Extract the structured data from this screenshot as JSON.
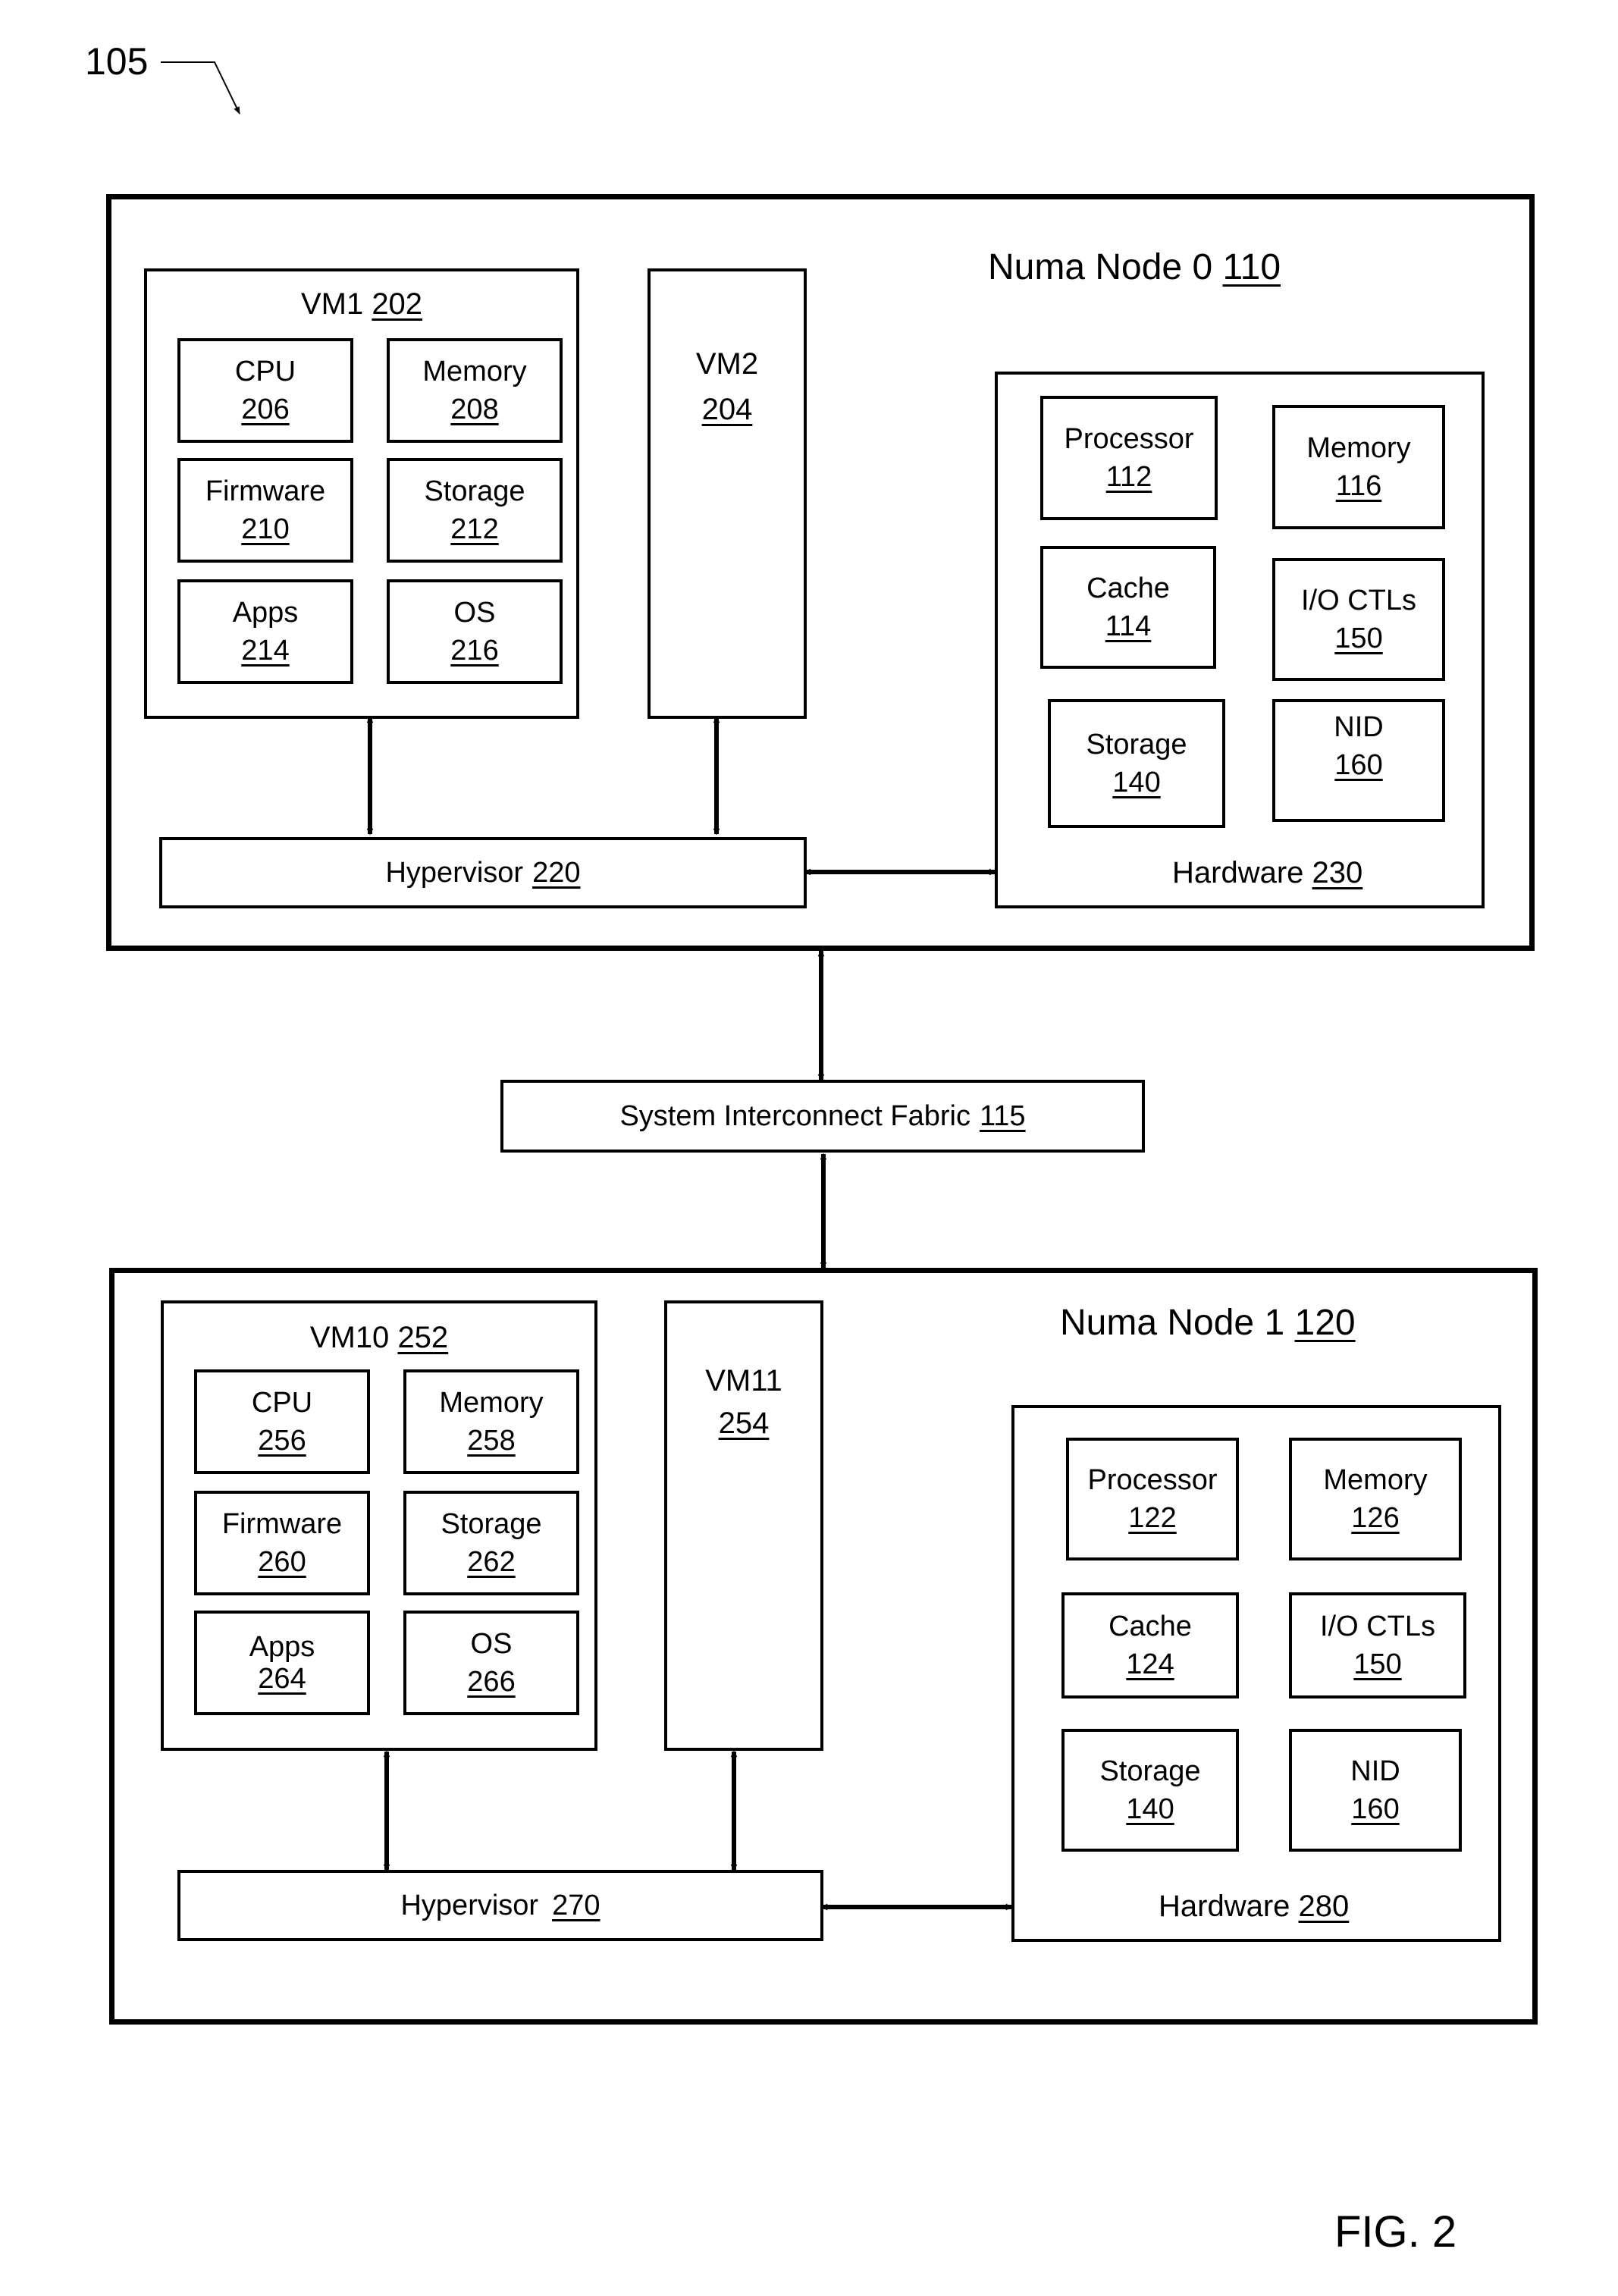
{
  "figure": {
    "reference": "105",
    "caption": "FIG. 2"
  },
  "node0": {
    "name": "Numa Node 0",
    "ref": "110",
    "vm_a": {
      "name": "VM1",
      "ref": "202",
      "components": [
        {
          "name": "CPU",
          "ref": "206"
        },
        {
          "name": "Memory",
          "ref": "208"
        },
        {
          "name": "Firmware",
          "ref": "210"
        },
        {
          "name": "Storage",
          "ref": "212"
        },
        {
          "name": "Apps",
          "ref": "214"
        },
        {
          "name": "OS",
          "ref": "216"
        }
      ]
    },
    "vm_b": {
      "name": "VM2",
      "ref": "204"
    },
    "hypervisor": {
      "name": "Hypervisor",
      "ref": "220"
    },
    "hardware": {
      "name": "Hardware",
      "ref": "230",
      "components": [
        {
          "name": "Processor",
          "ref": "112"
        },
        {
          "name": "Memory",
          "ref": "116"
        },
        {
          "name": "Cache",
          "ref": "114"
        },
        {
          "name": "I/O CTLs",
          "ref": "150"
        },
        {
          "name": "Storage",
          "ref": "140"
        },
        {
          "name": "NID",
          "ref": "160"
        }
      ]
    }
  },
  "fabric": {
    "name": "System Interconnect Fabric",
    "ref": "115"
  },
  "node1": {
    "name": "Numa Node 1",
    "ref": "120",
    "vm_a": {
      "name": "VM10",
      "ref": "252",
      "components": [
        {
          "name": "CPU",
          "ref": "256"
        },
        {
          "name": "Memory",
          "ref": "258"
        },
        {
          "name": "Firmware",
          "ref": "260"
        },
        {
          "name": "Storage",
          "ref": "262"
        },
        {
          "name": "Apps",
          "ref": "264"
        },
        {
          "name": "OS",
          "ref": "266"
        }
      ]
    },
    "vm_b": {
      "name": "VM11",
      "ref": "254"
    },
    "hypervisor": {
      "name": "Hypervisor",
      "ref": "270"
    },
    "hardware": {
      "name": "Hardware",
      "ref": "280",
      "components": [
        {
          "name": "Processor",
          "ref": "122"
        },
        {
          "name": "Memory",
          "ref": "126"
        },
        {
          "name": "Cache",
          "ref": "124"
        },
        {
          "name": "I/O CTLs",
          "ref": "150"
        },
        {
          "name": "Storage",
          "ref": "140"
        },
        {
          "name": "NID",
          "ref": "160"
        }
      ]
    }
  }
}
